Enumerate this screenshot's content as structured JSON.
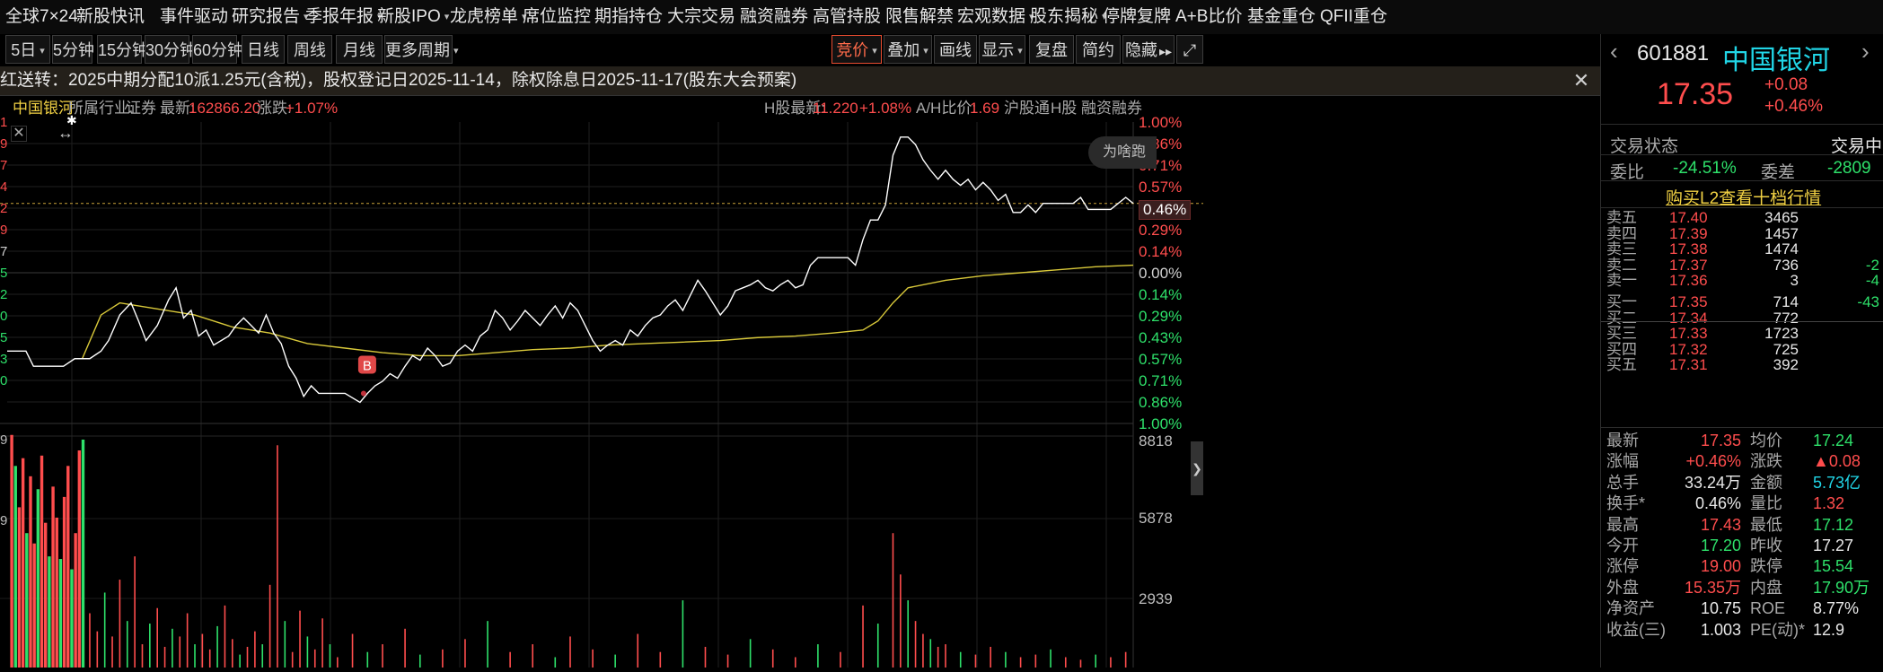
{
  "topnav": {
    "items": [
      {
        "label": "全球7×24",
        "caret": false
      },
      {
        "label": "新股快讯",
        "caret": false
      },
      {
        "label": "事件驱动",
        "caret": false
      },
      {
        "label": "研究报告",
        "caret": true
      },
      {
        "label": "季报年报",
        "caret": true
      },
      {
        "label": "新股IPO",
        "caret": true
      },
      {
        "label": "龙虎榜单",
        "caret": true
      },
      {
        "label": "席位监控",
        "caret": false
      },
      {
        "label": "期指持仓",
        "caret": false
      },
      {
        "label": "大宗交易",
        "caret": false
      },
      {
        "label": "融资融券",
        "caret": false
      },
      {
        "label": "高管持股",
        "caret": false
      },
      {
        "label": "限售解禁",
        "caret": false
      },
      {
        "label": "宏观数据",
        "caret": true
      },
      {
        "label": "股东揭秘",
        "caret": true
      },
      {
        "label": "停牌复牌",
        "caret": false
      },
      {
        "label": "A+B比价",
        "caret": false
      },
      {
        "label": "基金重仓",
        "caret": false
      },
      {
        "label": "QFII重仓",
        "caret": false
      }
    ]
  },
  "toolbar": {
    "periods": [
      "5日",
      "5分钟",
      "15分钟",
      "30分钟",
      "60分钟",
      "日线",
      "周线",
      "月线",
      "更多周期"
    ],
    "right_buttons": [
      "竞价",
      "叠加",
      "画线",
      "显示",
      "复盘",
      "简约",
      "隐藏"
    ],
    "first_caret": "▾",
    "hide_arrows": "▸▸",
    "fullscreen_icon": "⤢"
  },
  "banner": {
    "text": "红送转：2025中期分配10派1.25元(含税)，股权登记日2025-11-14，除权除息日2025-11-17(股东大会预案)",
    "close": "✕"
  },
  "infobar": {
    "stock_name": "中国银河",
    "industry_label": "所属行业:",
    "industry": "证券",
    "latest_label": "最新:",
    "latest": "162866.20",
    "change_label": "涨跌:",
    "change": "+1.07%",
    "h_label": "H股最新:",
    "h_latest": "11.220",
    "h_change": "+1.08%",
    "ah_label": "A/H比价:",
    "ah_ratio": "1.69",
    "tag1": "沪股通",
    "tag2": "H股",
    "tag3": "融资融券"
  },
  "chart": {
    "y_right_labels": [
      "1.00%",
      "0.86%",
      "0.71%",
      "0.57%",
      "0.46%",
      "0.29%",
      "0.14%",
      "0.00%",
      "0.14%",
      "0.29%",
      "0.43%",
      "0.57%",
      "0.71%",
      "0.86%",
      "1.00%"
    ],
    "y_left_labels": [
      "4",
      "1",
      "9",
      "7",
      "4",
      "2",
      "9",
      "7",
      "5",
      "2",
      "0",
      "5",
      "3",
      "0"
    ],
    "vol_labels": [
      "8818",
      "5878",
      "2939"
    ],
    "vol_left_labels": [
      "9",
      "9"
    ],
    "current_label": "0.46%",
    "marker": "B",
    "why_text": "为啥跑",
    "close_icon": "✕",
    "arrows_icon": "↔",
    "star_icon": "✱",
    "collapse_icon": "❯"
  },
  "chart_data": {
    "type": "line",
    "price_line": [
      [
        0,
        -0.52
      ],
      [
        5,
        -0.52
      ],
      [
        7,
        -0.62
      ],
      [
        12,
        -0.62
      ],
      [
        15,
        -0.62
      ],
      [
        18,
        -0.57
      ],
      [
        20,
        -0.57
      ],
      [
        22,
        -0.57
      ],
      [
        25,
        -0.52
      ],
      [
        27,
        -0.45
      ],
      [
        30,
        -0.28
      ],
      [
        33,
        -0.2
      ],
      [
        35,
        -0.32
      ],
      [
        37,
        -0.45
      ],
      [
        40,
        -0.35
      ],
      [
        43,
        -0.18
      ],
      [
        45,
        -0.1
      ],
      [
        47,
        -0.3
      ],
      [
        49,
        -0.25
      ],
      [
        51,
        -0.42
      ],
      [
        53,
        -0.38
      ],
      [
        55,
        -0.48
      ],
      [
        57,
        -0.45
      ],
      [
        59,
        -0.42
      ],
      [
        61,
        -0.35
      ],
      [
        63,
        -0.3
      ],
      [
        65,
        -0.35
      ],
      [
        67,
        -0.4
      ],
      [
        69,
        -0.28
      ],
      [
        71,
        -0.4
      ],
      [
        73,
        -0.47
      ],
      [
        75,
        -0.62
      ],
      [
        77,
        -0.7
      ],
      [
        79,
        -0.82
      ],
      [
        81,
        -0.75
      ],
      [
        83,
        -0.8
      ],
      [
        86,
        -0.8
      ],
      [
        90,
        -0.8
      ],
      [
        94,
        -0.86
      ],
      [
        96,
        -0.8
      ],
      [
        98,
        -0.75
      ],
      [
        100,
        -0.72
      ],
      [
        102,
        -0.67
      ],
      [
        104,
        -0.7
      ],
      [
        106,
        -0.62
      ],
      [
        108,
        -0.55
      ],
      [
        110,
        -0.58
      ],
      [
        112,
        -0.5
      ],
      [
        114,
        -0.55
      ],
      [
        116,
        -0.62
      ],
      [
        118,
        -0.6
      ],
      [
        120,
        -0.52
      ],
      [
        122,
        -0.48
      ],
      [
        124,
        -0.52
      ],
      [
        126,
        -0.42
      ],
      [
        128,
        -0.38
      ],
      [
        130,
        -0.25
      ],
      [
        132,
        -0.3
      ],
      [
        134,
        -0.38
      ],
      [
        136,
        -0.32
      ],
      [
        138,
        -0.25
      ],
      [
        140,
        -0.3
      ],
      [
        142,
        -0.35
      ],
      [
        144,
        -0.28
      ],
      [
        146,
        -0.22
      ],
      [
        148,
        -0.3
      ],
      [
        150,
        -0.2
      ],
      [
        152,
        -0.25
      ],
      [
        154,
        -0.35
      ],
      [
        156,
        -0.45
      ],
      [
        158,
        -0.52
      ],
      [
        160,
        -0.48
      ],
      [
        162,
        -0.45
      ],
      [
        164,
        -0.48
      ],
      [
        166,
        -0.38
      ],
      [
        168,
        -0.42
      ],
      [
        170,
        -0.35
      ],
      [
        172,
        -0.3
      ],
      [
        174,
        -0.28
      ],
      [
        176,
        -0.22
      ],
      [
        178,
        -0.18
      ],
      [
        180,
        -0.25
      ],
      [
        182,
        -0.15
      ],
      [
        184,
        -0.05
      ],
      [
        186,
        -0.12
      ],
      [
        188,
        -0.2
      ],
      [
        190,
        -0.28
      ],
      [
        192,
        -0.22
      ],
      [
        194,
        -0.12
      ],
      [
        196,
        -0.1
      ],
      [
        198,
        -0.08
      ],
      [
        200,
        -0.05
      ],
      [
        202,
        -0.1
      ],
      [
        204,
        -0.12
      ],
      [
        206,
        -0.08
      ],
      [
        208,
        -0.05
      ],
      [
        210,
        -0.1
      ],
      [
        212,
        -0.08
      ],
      [
        214,
        0.05
      ],
      [
        216,
        0.1
      ],
      [
        218,
        0.1
      ],
      [
        222,
        0.1
      ],
      [
        224,
        0.1
      ],
      [
        226,
        0.05
      ],
      [
        228,
        0.22
      ],
      [
        230,
        0.35
      ],
      [
        232,
        0.35
      ],
      [
        234,
        0.45
      ],
      [
        236,
        0.78
      ],
      [
        238,
        0.9
      ],
      [
        240,
        0.9
      ],
      [
        242,
        0.85
      ],
      [
        244,
        0.75
      ],
      [
        246,
        0.68
      ],
      [
        248,
        0.62
      ],
      [
        250,
        0.68
      ],
      [
        252,
        0.62
      ],
      [
        254,
        0.58
      ],
      [
        256,
        0.62
      ],
      [
        258,
        0.55
      ],
      [
        260,
        0.6
      ],
      [
        262,
        0.55
      ],
      [
        264,
        0.48
      ],
      [
        266,
        0.52
      ],
      [
        268,
        0.4
      ],
      [
        270,
        0.4
      ],
      [
        272,
        0.45
      ],
      [
        274,
        0.4
      ],
      [
        276,
        0.46
      ],
      [
        280,
        0.46
      ],
      [
        284,
        0.46
      ],
      [
        286,
        0.5
      ],
      [
        288,
        0.42
      ],
      [
        290,
        0.42
      ],
      [
        294,
        0.42
      ],
      [
        296,
        0.46
      ],
      [
        298,
        0.5
      ],
      [
        300,
        0.46
      ]
    ],
    "avg_line": [
      [
        20,
        -0.57
      ],
      [
        25,
        -0.28
      ],
      [
        30,
        -0.2
      ],
      [
        40,
        -0.24
      ],
      [
        50,
        -0.28
      ],
      [
        60,
        -0.36
      ],
      [
        70,
        -0.4
      ],
      [
        80,
        -0.47
      ],
      [
        90,
        -0.5
      ],
      [
        100,
        -0.53
      ],
      [
        110,
        -0.55
      ],
      [
        120,
        -0.55
      ],
      [
        130,
        -0.53
      ],
      [
        140,
        -0.51
      ],
      [
        150,
        -0.5
      ],
      [
        160,
        -0.48
      ],
      [
        170,
        -0.47
      ],
      [
        180,
        -0.46
      ],
      [
        190,
        -0.45
      ],
      [
        200,
        -0.43
      ],
      [
        210,
        -0.42
      ],
      [
        220,
        -0.4
      ],
      [
        228,
        -0.38
      ],
      [
        232,
        -0.32
      ],
      [
        236,
        -0.2
      ],
      [
        240,
        -0.1
      ],
      [
        250,
        -0.05
      ],
      [
        260,
        -0.02
      ],
      [
        270,
        0.0
      ],
      [
        280,
        0.02
      ],
      [
        290,
        0.04
      ],
      [
        300,
        0.05
      ]
    ],
    "xlim": [
      0,
      300
    ],
    "ylim": [
      -1.0,
      1.0
    ],
    "reference_level": 0.46,
    "volume": [
      [
        1,
        9000
      ],
      [
        2,
        7800
      ],
      [
        3,
        6200
      ],
      [
        4,
        8100
      ],
      [
        5,
        5200
      ],
      [
        6,
        7400
      ],
      [
        7,
        4800
      ],
      [
        8,
        6900
      ],
      [
        9,
        8200
      ],
      [
        10,
        5600
      ],
      [
        11,
        4300
      ],
      [
        12,
        7000
      ],
      [
        13,
        5800
      ],
      [
        14,
        4200
      ],
      [
        15,
        6600
      ],
      [
        16,
        7800
      ],
      [
        17,
        3800
      ],
      [
        18,
        5200
      ],
      [
        19,
        8400
      ],
      [
        20,
        8818
      ],
      [
        22,
        2100
      ],
      [
        24,
        1400
      ],
      [
        26,
        2900
      ],
      [
        28,
        1200
      ],
      [
        30,
        3400
      ],
      [
        32,
        1800
      ],
      [
        34,
        4300
      ],
      [
        36,
        900
      ],
      [
        38,
        1700
      ],
      [
        40,
        2300
      ],
      [
        42,
        800
      ],
      [
        44,
        1500
      ],
      [
        46,
        1200
      ],
      [
        48,
        2100
      ],
      [
        50,
        900
      ],
      [
        52,
        1300
      ],
      [
        54,
        700
      ],
      [
        56,
        1600
      ],
      [
        58,
        2400
      ],
      [
        60,
        1100
      ],
      [
        62,
        500
      ],
      [
        64,
        800
      ],
      [
        66,
        1400
      ],
      [
        68,
        900
      ],
      [
        70,
        3200
      ],
      [
        72,
        8600
      ],
      [
        74,
        1800
      ],
      [
        76,
        600
      ],
      [
        78,
        2200
      ],
      [
        80,
        1200
      ],
      [
        82,
        700
      ],
      [
        84,
        1900
      ],
      [
        86,
        900
      ],
      [
        88,
        400
      ],
      [
        92,
        1300
      ],
      [
        96,
        600
      ],
      [
        100,
        900
      ],
      [
        106,
        1500
      ],
      [
        110,
        500
      ],
      [
        116,
        700
      ],
      [
        122,
        1100
      ],
      [
        128,
        1800
      ],
      [
        134,
        600
      ],
      [
        140,
        900
      ],
      [
        146,
        400
      ],
      [
        150,
        1200
      ],
      [
        156,
        700
      ],
      [
        162,
        500
      ],
      [
        168,
        1300
      ],
      [
        174,
        600
      ],
      [
        180,
        2600
      ],
      [
        186,
        800
      ],
      [
        192,
        500
      ],
      [
        198,
        1100
      ],
      [
        204,
        700
      ],
      [
        210,
        400
      ],
      [
        216,
        900
      ],
      [
        222,
        600
      ],
      [
        228,
        2400
      ],
      [
        232,
        1700
      ],
      [
        236,
        5200
      ],
      [
        238,
        3600
      ],
      [
        240,
        2600
      ],
      [
        242,
        1800
      ],
      [
        244,
        1300
      ],
      [
        246,
        1100
      ],
      [
        248,
        800
      ],
      [
        250,
        900
      ],
      [
        254,
        600
      ],
      [
        258,
        500
      ],
      [
        262,
        800
      ],
      [
        266,
        600
      ],
      [
        270,
        400
      ],
      [
        274,
        500
      ],
      [
        278,
        700
      ],
      [
        282,
        400
      ],
      [
        286,
        300
      ],
      [
        290,
        500
      ],
      [
        294,
        400
      ],
      [
        298,
        600
      ]
    ],
    "volume_ylim": [
      0,
      8818
    ]
  },
  "quote": {
    "code": "601881",
    "name": "中国银河",
    "price": "17.35",
    "change": "+0.08",
    "change_pct": "+0.46%",
    "status_label": "交易状态",
    "status_value": "交易中",
    "webi_label": "委比",
    "webi_value": "-24.51%",
    "wecha_label": "委差",
    "wecha_value": "-2809",
    "l2_link": "购买L2查看十档行情",
    "asks": [
      {
        "label": "卖五",
        "price": "17.40",
        "vol": "3465",
        "chg": ""
      },
      {
        "label": "卖四",
        "price": "17.39",
        "vol": "1457",
        "chg": ""
      },
      {
        "label": "卖三",
        "price": "17.38",
        "vol": "1474",
        "chg": ""
      },
      {
        "label": "卖二",
        "price": "17.37",
        "vol": "736",
        "chg": "-2"
      },
      {
        "label": "卖一",
        "price": "17.36",
        "vol": "3",
        "chg": "-4"
      }
    ],
    "bids": [
      {
        "label": "买一",
        "price": "17.35",
        "vol": "714",
        "chg": "-43"
      },
      {
        "label": "买二",
        "price": "17.34",
        "vol": "772",
        "chg": ""
      },
      {
        "label": "买三",
        "price": "17.33",
        "vol": "1723",
        "chg": ""
      },
      {
        "label": "买四",
        "price": "17.32",
        "vol": "725",
        "chg": ""
      },
      {
        "label": "买五",
        "price": "17.31",
        "vol": "392",
        "chg": ""
      }
    ],
    "stats": [
      {
        "l1": "最新",
        "v1": "17.35",
        "c1": "red",
        "l2": "均价",
        "v2": "17.24",
        "c2": "green"
      },
      {
        "l1": "涨幅",
        "v1": "+0.46%",
        "c1": "red",
        "l2": "涨跌",
        "v2": "▲0.08",
        "c2": "red"
      },
      {
        "l1": "总手",
        "v1": "33.24万",
        "c1": "white",
        "l2": "金额",
        "v2": "5.73亿",
        "c2": "cyan"
      },
      {
        "l1": "换手*",
        "v1": "0.46%",
        "c1": "white",
        "l2": "量比",
        "v2": "1.32",
        "c2": "red"
      },
      {
        "l1": "最高",
        "v1": "17.43",
        "c1": "red",
        "l2": "最低",
        "v2": "17.12",
        "c2": "green"
      },
      {
        "l1": "今开",
        "v1": "17.20",
        "c1": "green",
        "l2": "昨收",
        "v2": "17.27",
        "c2": "white"
      },
      {
        "l1": "涨停",
        "v1": "19.00",
        "c1": "red",
        "l2": "跌停",
        "v2": "15.54",
        "c2": "green"
      },
      {
        "l1": "外盘",
        "v1": "15.35万",
        "c1": "red",
        "l2": "内盘",
        "v2": "17.90万",
        "c2": "green"
      },
      {
        "l1": "净资产",
        "v1": "10.75",
        "c1": "white",
        "l2": "ROE",
        "v2": "8.77%",
        "c2": "white"
      },
      {
        "l1": "收益(三)",
        "v1": "1.003",
        "c1": "white",
        "l2": "PE(动)*",
        "v2": "12.9",
        "c2": "white"
      }
    ]
  },
  "colors": {
    "up": "#ff4d4d",
    "down": "#2ee06a",
    "avg": "#d9c93a",
    "price": "#ffffff",
    "accent": "#ff6b4a"
  }
}
